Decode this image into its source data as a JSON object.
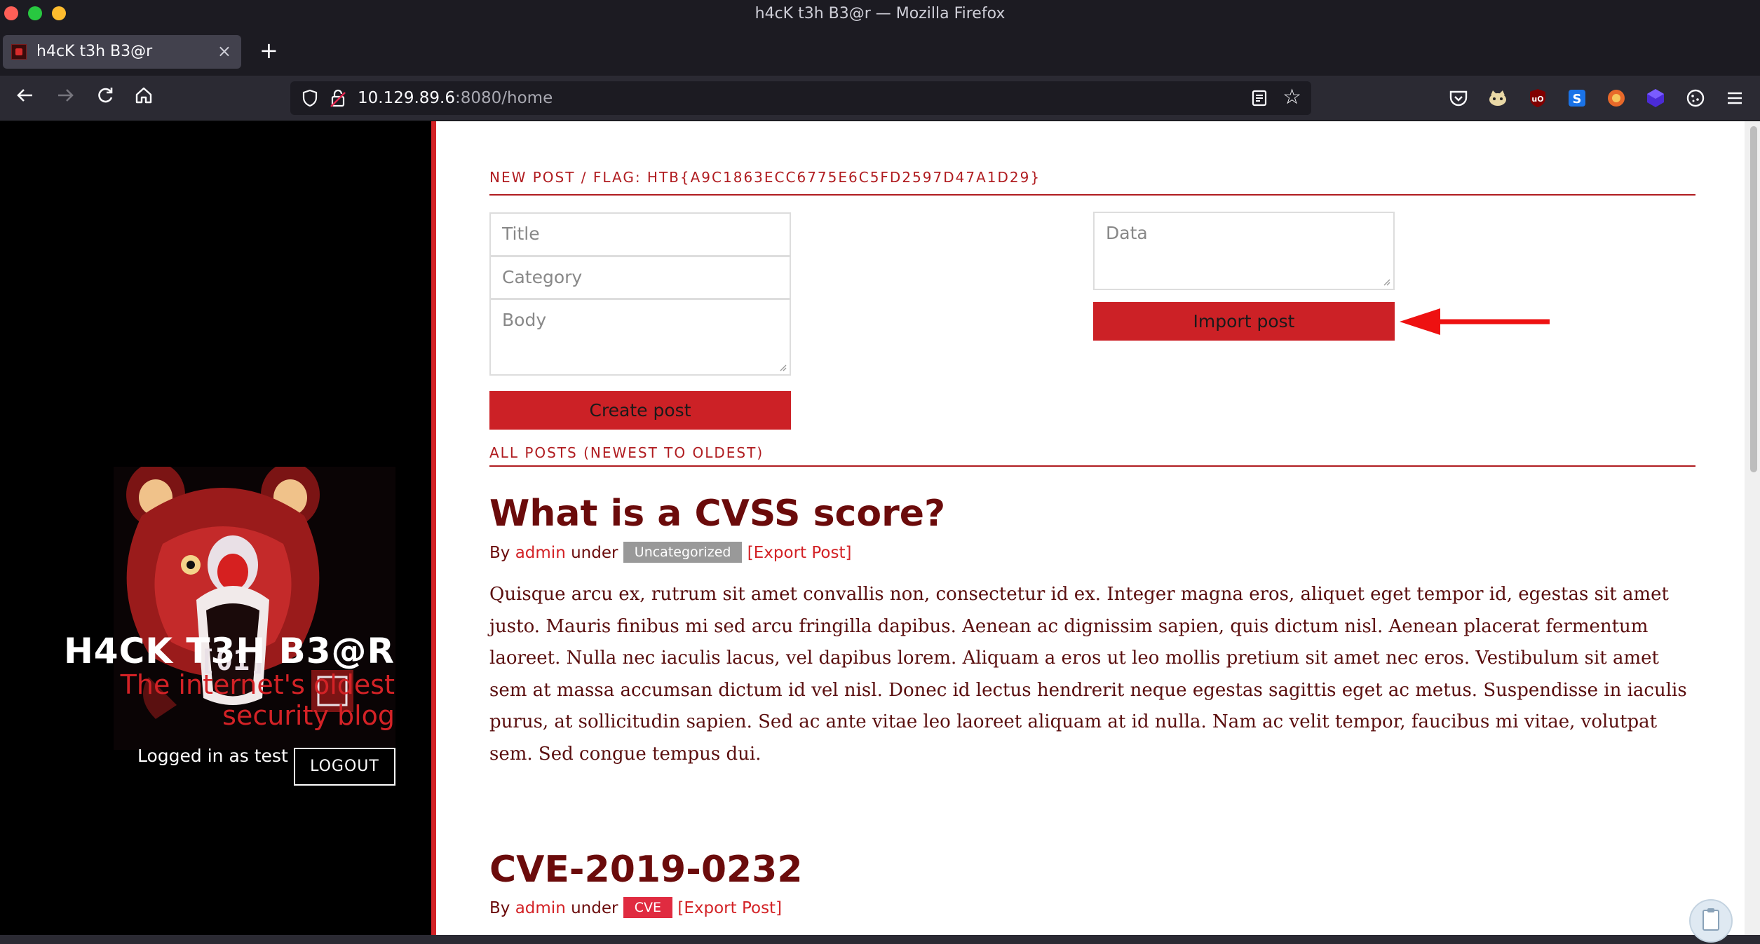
{
  "window": {
    "title": "h4cK t3h B3@r — Mozilla Firefox"
  },
  "tab": {
    "title": "h4cK t3h B3@r",
    "close": "×",
    "new_tab": "+"
  },
  "url": {
    "host": "10.129.89.6",
    "port_path": ":8080/home"
  },
  "sidebar": {
    "site_title": "H4CK T3H B3@R",
    "tagline": "The internet's oldest security blog",
    "logged_in": "Logged in as test",
    "logout": "LOGOUT"
  },
  "new_post": {
    "heading": "NEW POST / FLAG: HTB{A9C1863ECC6775E6C5FD2597D47A1D29}",
    "title_placeholder": "Title",
    "category_placeholder": "Category",
    "body_placeholder": "Body",
    "create_label": "Create post",
    "data_placeholder": "Data",
    "import_label": "Import post"
  },
  "all_posts": {
    "heading": "ALL POSTS (NEWEST TO OLDEST)"
  },
  "posts": [
    {
      "title": "What is a CVSS score?",
      "by": "By",
      "author": "admin",
      "under": "under",
      "category": "Uncategorized",
      "export": "[Export Post]",
      "body": "Quisque arcu ex, rutrum sit amet convallis non, consectetur id ex. Integer magna eros, aliquet eget tempor id, egestas sit amet justo. Mauris finibus mi sed arcu fringilla dapibus. Aenean ac dignissim sapien, quis dictum nisl. Aenean placerat fermentum laoreet. Nulla nec iaculis lacus, vel dapibus lorem. Aliquam a eros ut leo mollis pretium sit amet nec eros. Vestibulum sit amet sem at massa accumsan dictum id vel nisl. Donec id lectus hendrerit neque egestas sagittis eget ac metus. Suspendisse in iaculis purus, at sollicitudin sapien. Sed ac ante vitae leo laoreet aliquam at id nulla. Nam ac velit tempor, faucibus mi vitae, volutpat sem. Sed congue tempus dui."
    },
    {
      "title": "CVE-2019-0232",
      "by": "By",
      "author": "admin",
      "under": "under",
      "category": "CVE",
      "export": "[Export Post]"
    }
  ],
  "colors": {
    "accent": "#d32226",
    "button": "#cc2126",
    "annotation_arrow": "#ee1111"
  }
}
